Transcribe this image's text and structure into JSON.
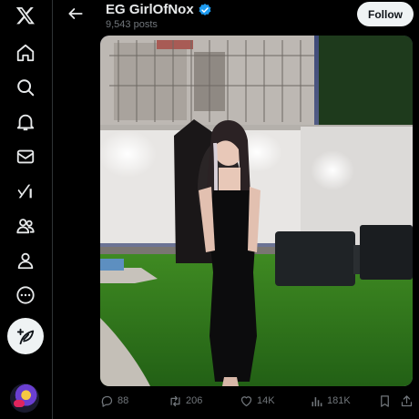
{
  "header": {
    "title": "EG GirlOfNox",
    "subtitle": "9,543 posts",
    "follow_label": "Follow"
  },
  "post": {
    "replies": "88",
    "reposts": "206",
    "likes": "14K",
    "views": "181K"
  },
  "icons": {
    "logo": "x-logo-icon",
    "nav": [
      "home-icon",
      "search-icon",
      "notifications-icon",
      "messages-icon",
      "grok-icon",
      "communities-icon",
      "profile-icon",
      "more-icon"
    ],
    "compose": "compose-post-icon",
    "verified": "verified-badge-icon"
  },
  "colors": {
    "background": "#000000",
    "verified": "#1d9bf0",
    "muted_text": "#71767b",
    "follow_button": "#eff3f4"
  }
}
